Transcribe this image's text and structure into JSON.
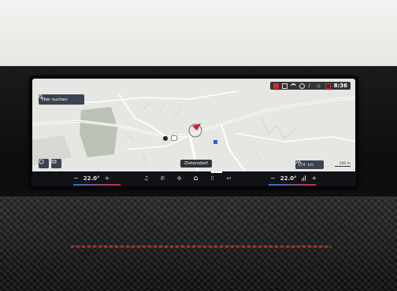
{
  "status_bar": {
    "time": "8:36"
  },
  "map": {
    "search_placeholder": "Hier suchen",
    "poi_label": "",
    "destination": "Zistersdorf",
    "range_value": "174",
    "range_unit": "km",
    "scale_label": "100 m"
  },
  "climate": {
    "left_temp": "22.0°",
    "right_temp": "22.0°",
    "minus": "−",
    "plus": "+"
  },
  "colors": {
    "bar_bg": "#111216",
    "accent_red": "#d03030",
    "accent_blue": "#2f6fe0"
  },
  "icons": [
    "search-icon",
    "layers-icon",
    "traffic-icon",
    "music-icon",
    "phone-icon",
    "fan-icon",
    "home-icon",
    "apps-icon",
    "back-icon",
    "range-icon",
    "seat-heat-icon",
    "bluetooth-icon",
    "wifi-icon",
    "notification-icon"
  ]
}
